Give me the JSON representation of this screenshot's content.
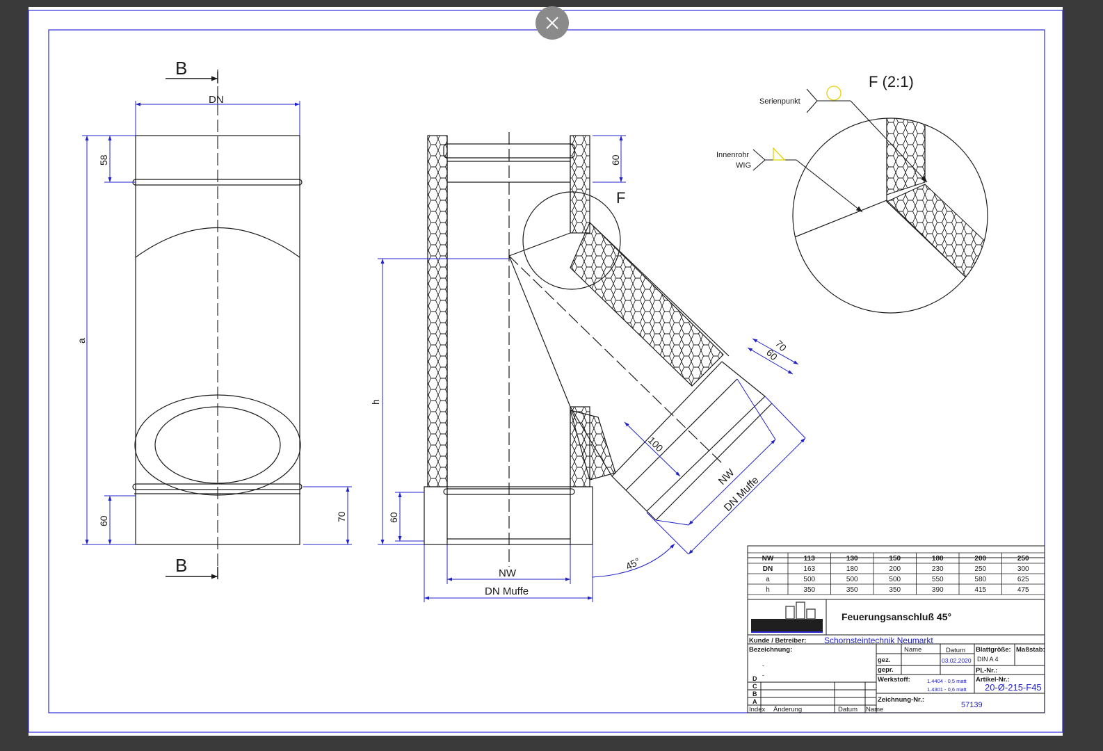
{
  "viewer": {
    "close_icon": "close-icon"
  },
  "drawing": {
    "left_view": {
      "section_top": "B",
      "section_bottom": "B",
      "dim_dn": "DN",
      "dim_58": "58",
      "dim_a": "a",
      "dim_60": "60",
      "dim_70": "70"
    },
    "middle_view": {
      "dim_60_top": "60",
      "detail_marker": "F",
      "dim_h": "h",
      "dim_60_bottom": "60",
      "dim_nw": "NW",
      "dim_dn_muffe": "DN Muffe",
      "branch_dim_70": "70",
      "branch_dim_60": "60",
      "branch_dim_100": "100",
      "branch_dim_nw": "NW",
      "branch_dim_dn_muffe": "DN Muffe",
      "angle": "45°"
    },
    "detail": {
      "title": "F (2:1)",
      "weld_1": "Serienpunkt",
      "weld_2_line1": "Innenrohr",
      "weld_2_line2": "WIG"
    }
  },
  "size_table": {
    "rows": [
      {
        "label": "NW",
        "values": [
          "113",
          "130",
          "150",
          "180",
          "200",
          "250"
        ]
      },
      {
        "label": "DN",
        "values": [
          "163",
          "180",
          "200",
          "230",
          "250",
          "300"
        ]
      },
      {
        "label": "a",
        "values": [
          "500",
          "500",
          "500",
          "550",
          "580",
          "625"
        ]
      },
      {
        "label": "h",
        "values": [
          "350",
          "350",
          "350",
          "390",
          "415",
          "475"
        ]
      }
    ]
  },
  "title_block": {
    "title": "Feuerungsanschluß 45°",
    "kunde_label": "Kunde / Betreiber:",
    "kunde_value": "Schornsteintechnik Neumarkt",
    "bezeichnung_label": "Bezeichnung:",
    "bez_dash_1": "-",
    "bez_dash_2": "-",
    "name_header": "Name",
    "datum_header": "Datum",
    "gez_label": "gez.",
    "gez_date": "03.02.2020",
    "gepr_label": "gepr.",
    "blattgroesse_label": "Blattgröße:",
    "blattgroesse_value": "DIN A 4",
    "massstab_label": "Maßstab:",
    "pl_nr_label": "PL-Nr.:",
    "werkstoff_label": "Werkstoff:",
    "werkstoff_1": "1.4404 - 0,5 matt",
    "werkstoff_2": "1.4301 - 0,6 matt",
    "artikel_label": "Artikel-Nr.:",
    "artikel_value": "20-Ø-215-F45",
    "zeichnung_label": "Zeichnung-Nr.:",
    "zeichnung_value": "57139",
    "rev_letters": [
      "D",
      "C",
      "B",
      "A"
    ],
    "index_label": "Index",
    "aenderung_label": "Änderung",
    "rev_datum_label": "Datum",
    "rev_name_label": "Name"
  },
  "colors": {
    "frame": "#2b2bd6",
    "line": "#1a1a1a",
    "dim": "#2020c8",
    "accent": "#1c1ccc",
    "weld": "#e8d000"
  }
}
